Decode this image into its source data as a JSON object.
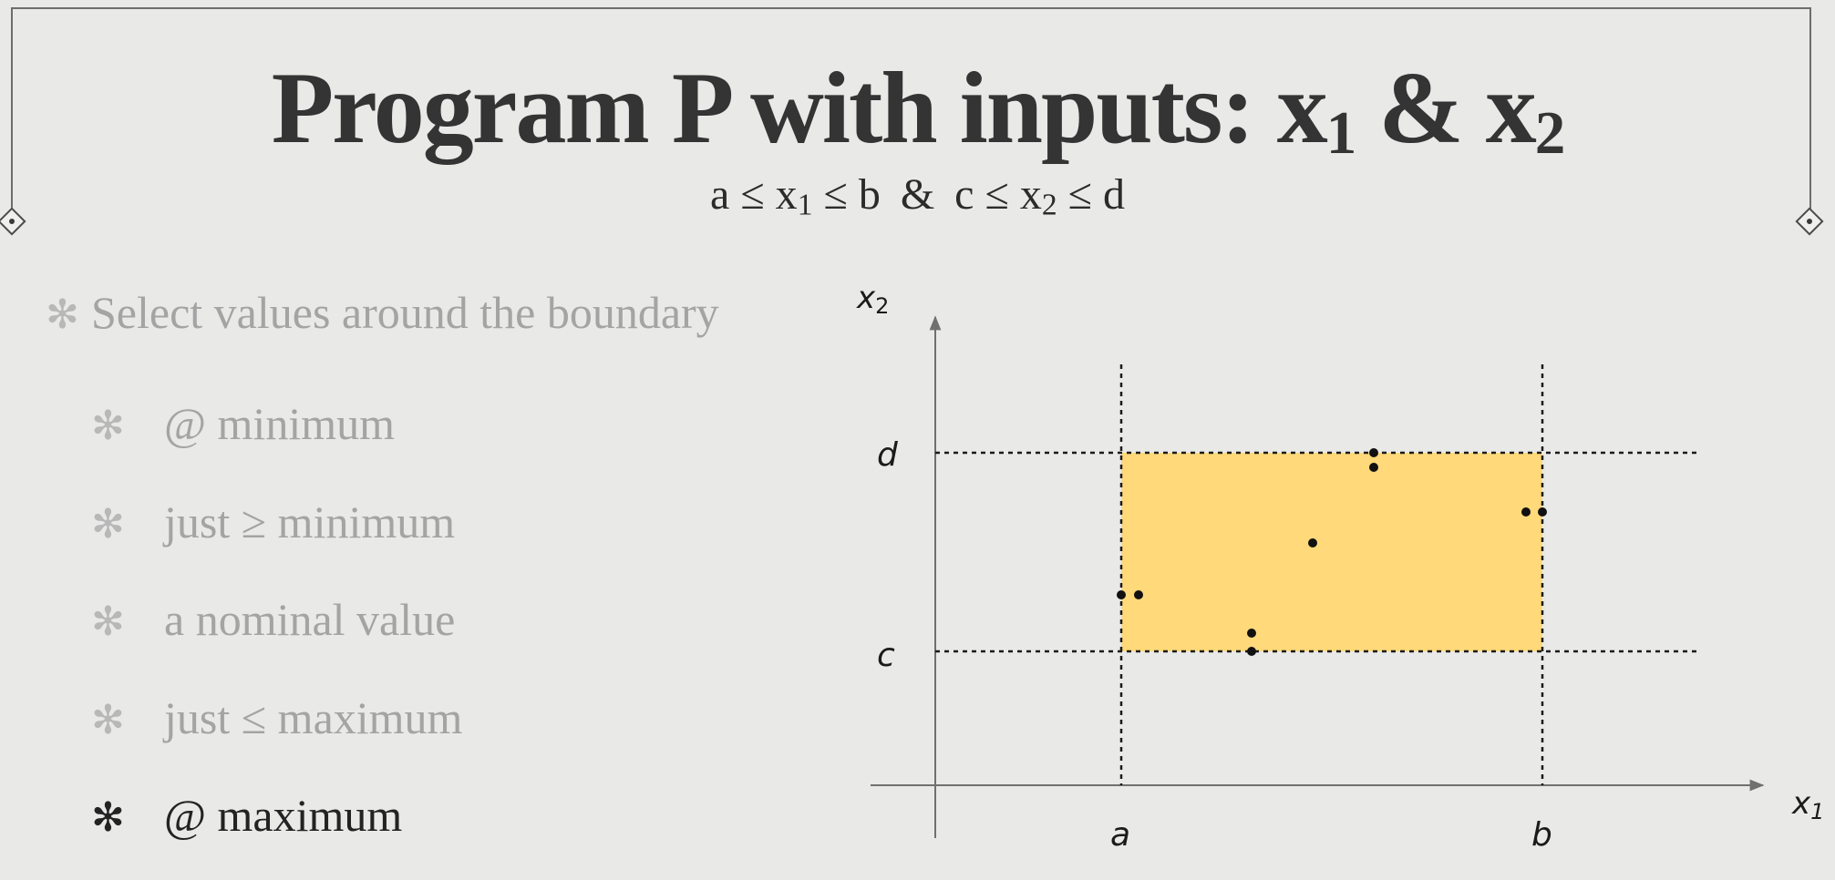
{
  "title": {
    "main": "Program P with inputs: ",
    "var1": "x",
    "var1_sub": "1",
    "amp": " & ",
    "var2": "x",
    "var2_sub": "2"
  },
  "subtitle": {
    "part1": "a ≤ x",
    "part1_sub": "1",
    "part2": " ≤ b",
    "amp": "&",
    "part3": "c ≤ x",
    "part3_sub": "2",
    "part4": " ≤ d"
  },
  "bullets": {
    "star": "✻",
    "main": "Select values around the boundary",
    "items": [
      {
        "label": "@ minimum",
        "active": false
      },
      {
        "label": "just ≥ minimum",
        "active": false
      },
      {
        "label": "a nominal value",
        "active": false
      },
      {
        "label": "just ≤ maximum",
        "active": false
      },
      {
        "label": "@ maximum",
        "active": true
      }
    ]
  },
  "diagram": {
    "axis_x_label": "x",
    "axis_x_sub": "1",
    "axis_y_label": "x",
    "axis_y_sub": "2",
    "a_label": "a",
    "b_label": "b",
    "c_label": "c",
    "d_label": "d",
    "region_color": "#ffd97a",
    "points_color": "#111111"
  }
}
